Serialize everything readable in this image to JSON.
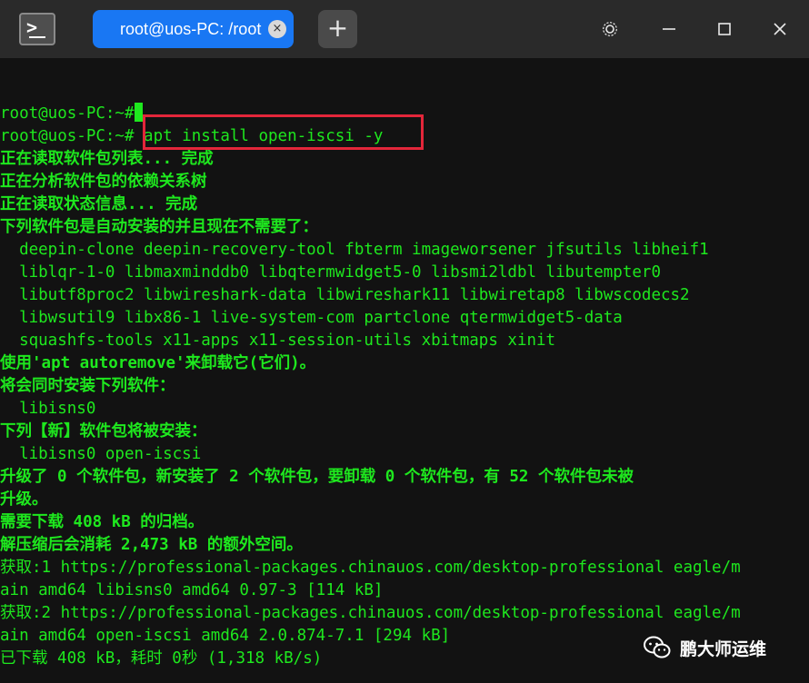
{
  "window": {
    "tab_title": "root@uos-PC: /root",
    "tab_close_glyph": "×",
    "add_tab_glyph": "+",
    "app_icon": "terminal-icon"
  },
  "terminal": {
    "lines": [
      "root@uos-PC:~#",
      "root@uos-PC:~# apt install open-iscsi -y",
      "正在读取软件包列表... 完成",
      "正在分析软件包的依赖关系树",
      "正在读取状态信息... 完成",
      "下列软件包是自动安装的并且现在不需要了：",
      "  deepin-clone deepin-recovery-tool fbterm imageworsener jfsutils libheif1",
      "  liblqr-1-0 libmaxminddb0 libqtermwidget5-0 libsmi2ldbl libutempter0",
      "  libutf8proc2 libwireshark-data libwireshark11 libwiretap8 libwscodecs2",
      "  libwsutil9 libx86-1 live-system-com partclone qtermwidget5-data",
      "  squashfs-tools x11-apps x11-session-utils xbitmaps xinit",
      "使用'apt autoremove'来卸载它(它们)。",
      "将会同时安装下列软件：",
      "  libisns0",
      "下列【新】软件包将被安装：",
      "  libisns0 open-iscsi",
      "升级了 0 个软件包，新安装了 2 个软件包，要卸载 0 个软件包，有 52 个软件包未被",
      "升级。",
      "需要下载 408 kB 的归档。",
      "解压缩后会消耗 2,473 kB 的额外空间。",
      "获取:1 https://professional-packages.chinauos.com/desktop-professional eagle/m",
      "ain amd64 libisns0 amd64 0.97-3 [114 kB]",
      "获取:2 https://professional-packages.chinauos.com/desktop-professional eagle/m",
      "ain amd64 open-iscsi amd64 2.0.874-7.1 [294 kB]",
      "已下载 408 kB，耗时 0秒 (1,318 kB/s)"
    ],
    "text_color": "#1ee81e",
    "background": "#121212",
    "highlight_color": "#e3263a"
  },
  "watermark": {
    "text": "鹏大师运维",
    "icon": "wechat-icon"
  }
}
